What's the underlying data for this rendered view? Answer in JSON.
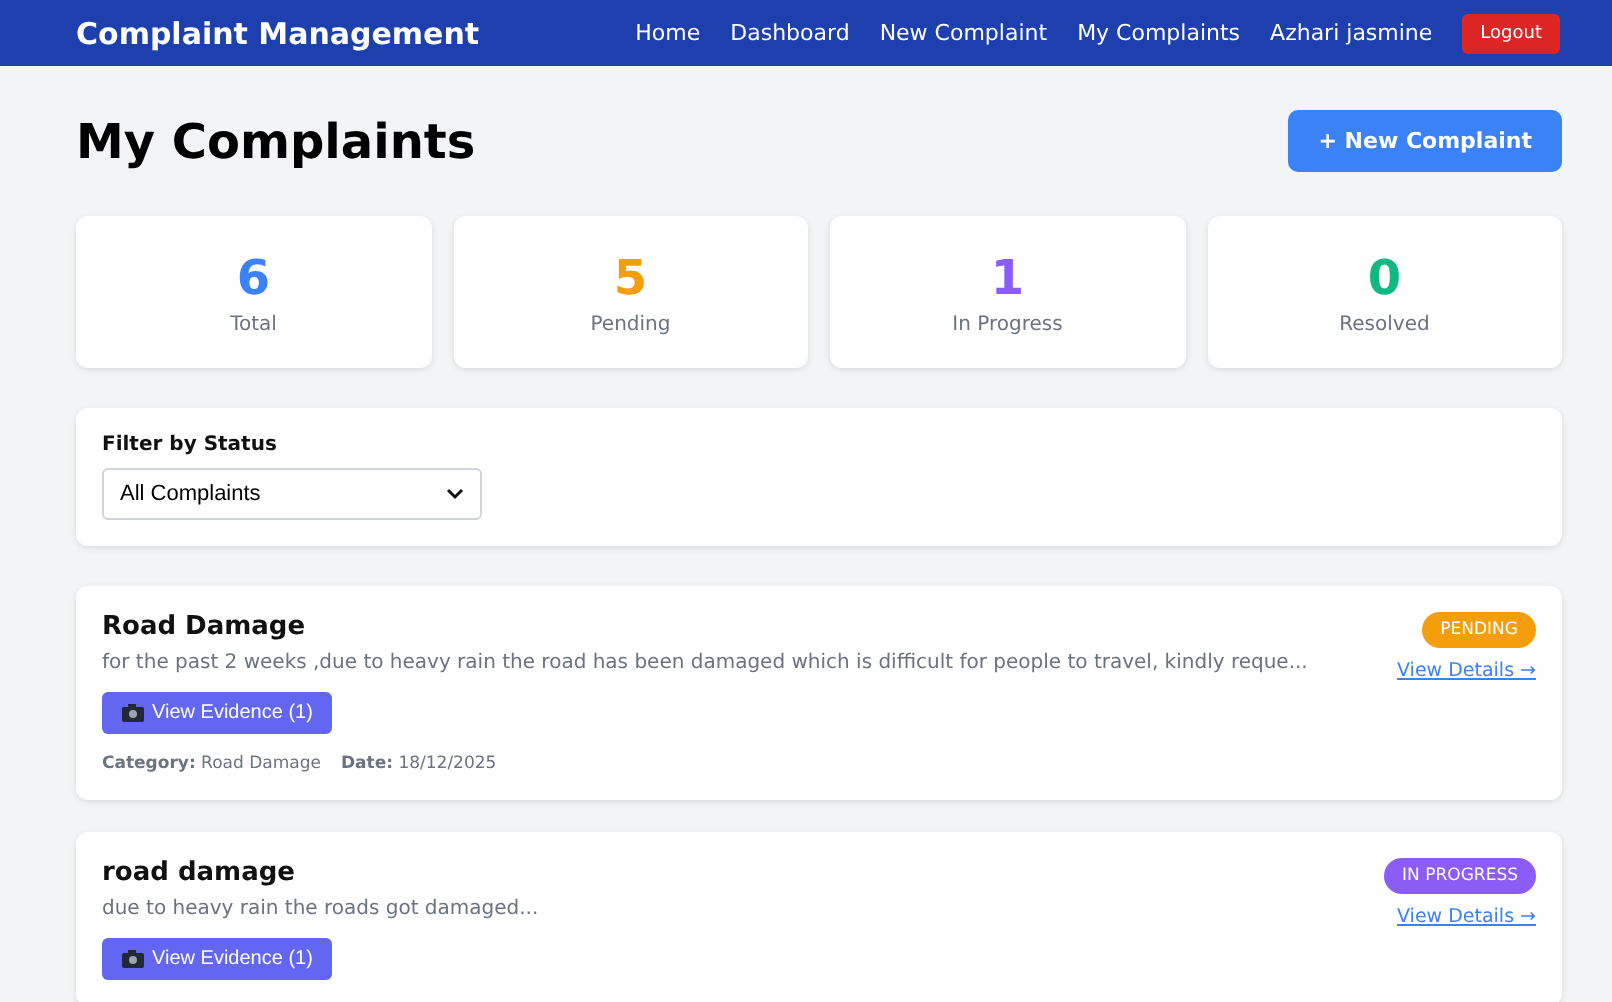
{
  "navbar": {
    "brand": "Complaint Management",
    "links": [
      {
        "label": "Home"
      },
      {
        "label": "Dashboard"
      },
      {
        "label": "New Complaint"
      },
      {
        "label": "My Complaints"
      }
    ],
    "user": "Azhari jasmine",
    "logout": "Logout"
  },
  "page": {
    "title": "My Complaints",
    "new_button": "+ New Complaint"
  },
  "stats": [
    {
      "value": "6",
      "label": "Total",
      "color": "#3b82f6"
    },
    {
      "value": "5",
      "label": "Pending",
      "color": "#f59e0b"
    },
    {
      "value": "1",
      "label": "In Progress",
      "color": "#8b5cf6"
    },
    {
      "value": "0",
      "label": "Resolved",
      "color": "#10b981"
    }
  ],
  "filter": {
    "label": "Filter by Status",
    "value": "All Complaints"
  },
  "complaints": [
    {
      "title": "Road Damage",
      "description": "for the past 2 weeks ,due to heavy rain the road has been damaged which is difficult for people to travel, kindly reque...",
      "status": "PENDING",
      "color": "#f59e0b",
      "details": "View Details →",
      "evidence": "View Evidence (1)",
      "meta": "**Category:** Road Damage",
      "date": "**Date:** 18/12/2025"
    },
    {
      "title": "road damage",
      "description": "due to heavy rain the roads got damaged...",
      "status": "IN PROGRESS",
      "color": "#8b5cf6",
      "details": "View Details →",
      "evidence": "View Evidence (1)"
    }
  ]
}
